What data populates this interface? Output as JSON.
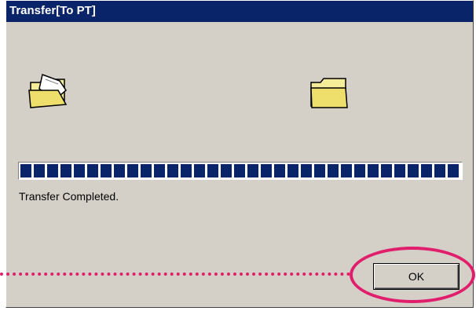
{
  "window": {
    "title": "Transfer[To PT]"
  },
  "icons": {
    "source": "folder-open-with-document-icon",
    "destination": "folder-icon"
  },
  "progress": {
    "fraction": 1.0
  },
  "status": {
    "text": "Transfer Completed."
  },
  "buttons": {
    "ok_label": "OK"
  },
  "colors": {
    "titlebar": "#0a246a",
    "dialog_background": "#d4d0c8",
    "progress_fill": "#0a246a",
    "highlight": "#e01e6c",
    "folder": "#f5ec9a"
  }
}
